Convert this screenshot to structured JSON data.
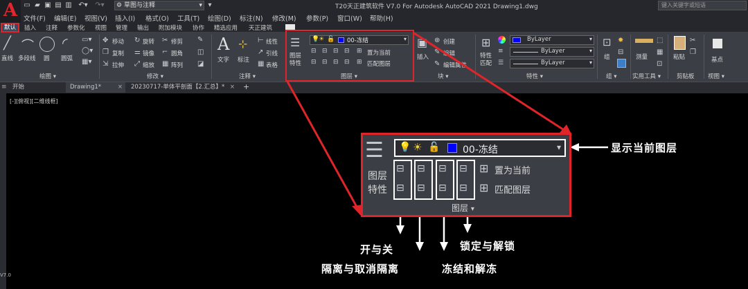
{
  "app": {
    "title": "T20天正建筑软件 V7.0 For Autodesk AutoCAD 2021    Drawing1.dwg",
    "logo": "A",
    "workspace": "草图与注释",
    "search_placeholder": "键入关键字或短语"
  },
  "menubar": [
    "文件(F)",
    "编辑(E)",
    "视图(V)",
    "插入(I)",
    "格式(O)",
    "工具(T)",
    "绘图(D)",
    "标注(N)",
    "修改(M)",
    "参数(P)",
    "窗口(W)",
    "帮助(H)"
  ],
  "ribbon_tabs": [
    "默认",
    "插入",
    "注释",
    "参数化",
    "视图",
    "管理",
    "输出",
    "附加模块",
    "协作",
    "精选应用",
    "天正建筑"
  ],
  "ribbon": {
    "draw": {
      "items": [
        "直线",
        "多段线",
        "圆",
        "圆弧"
      ],
      "label": "绘图 ▾"
    },
    "modify": {
      "items": [
        "移动",
        "旋转",
        "修剪",
        "复制",
        "镜像",
        "圆角",
        "拉伸",
        "缩放",
        "阵列"
      ],
      "label": "修改 ▾"
    },
    "annotation": {
      "items": [
        "文字",
        "标注",
        "线性",
        "引线",
        "表格"
      ],
      "label": "注释 ▾"
    },
    "layer": {
      "properties_label": "图层\n特性",
      "current_layer": "00-冻结",
      "set_current": "置为当前",
      "match_layer": "匹配图层",
      "label": "图层 ▾"
    },
    "insert": {
      "items": [
        "插入",
        "创建",
        "编辑",
        "编辑属性"
      ],
      "label": "块 ▾"
    },
    "properties": {
      "match_label": "特性\n匹配",
      "bylayer": [
        "ByLayer",
        "ByLayer",
        "ByLayer"
      ],
      "label": "特性 ▾"
    },
    "group": {
      "label": "组 ▾",
      "item": "组"
    },
    "utilities": {
      "label": "实用工具 ▾",
      "item": "测量"
    },
    "clipboard": {
      "label": "剪贴板",
      "item": "粘贴"
    },
    "view": {
      "label": "视图 ▾",
      "item": "基点"
    }
  },
  "doc_tabs": [
    "开始",
    "Drawing1*",
    "20230717-单体平剖面【2.汇总】*"
  ],
  "canvas": {
    "view_label": "[-][俯视][二维线框]",
    "version_mark": "V7.0"
  },
  "zoom_panel": {
    "current_layer": "00-冻结",
    "properties_label": "图层\n特性",
    "set_current": "置为当前",
    "match_layer": "匹配图层",
    "panel_label": "图层"
  },
  "annotations": {
    "current_layer": "显示当前图层",
    "on_off": "开与关",
    "isolate": "隔离与取消隔离",
    "lock": "锁定与解锁",
    "freeze": "冻结和解冻"
  },
  "colors": {
    "highlight": "#e0252a",
    "layer_swatch": "#0000ff",
    "ribbon_bg": "#3b3e45"
  }
}
